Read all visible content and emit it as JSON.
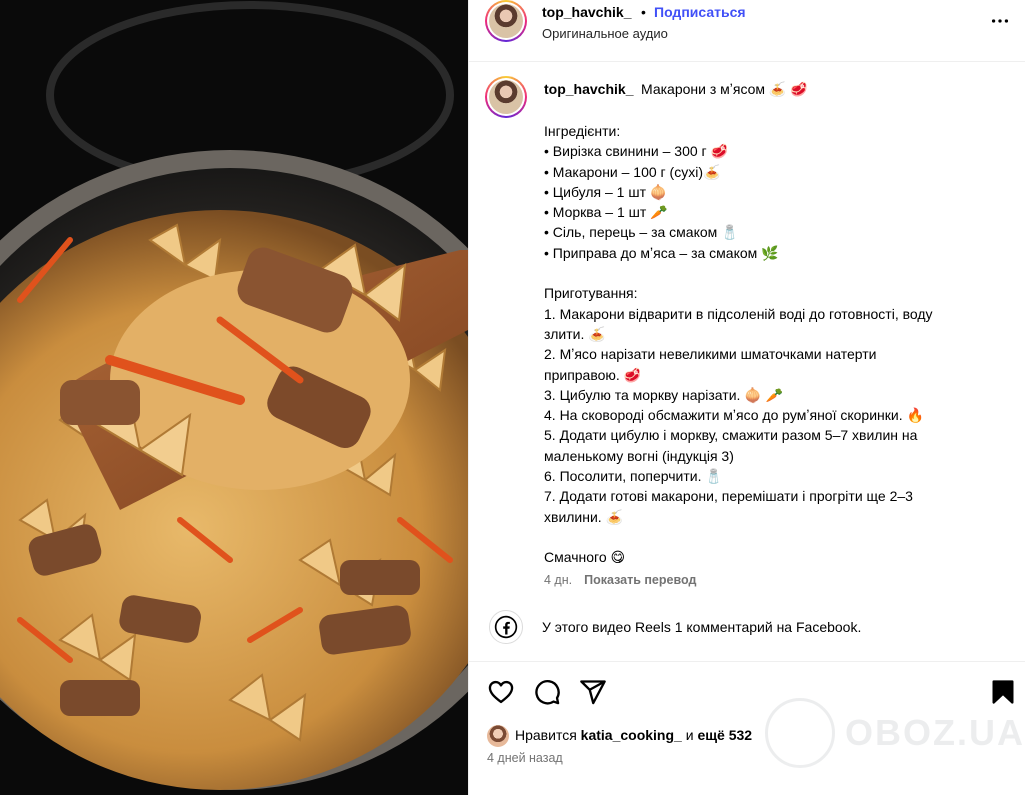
{
  "header": {
    "username": "top_havchik_",
    "separator": "•",
    "follow_label": "Подписаться",
    "audio_label": "Оригинальное аудио"
  },
  "caption": {
    "username": "top_havchik_",
    "title": "Макарони з мʼясом 🍝 🥩",
    "lines": [
      "Інгредієнти:",
      "• Вирізка свинини – 300 г 🥩",
      "• Макарони – 100 г (сухі)🍝",
      "• Цибуля – 1 шт 🧅",
      "• Морква – 1 шт 🥕",
      "• Сіль, перець – за смаком 🧂",
      "• Приправа до мʼяса – за смаком 🌿",
      "",
      "Приготування:",
      "1. Макарони відварити в підсоленій воді до готовності, воду",
      "злити. 🍝",
      "2. Мʼясо нарізати невеликими шматочками натерти",
      "приправою. 🥩",
      "3. Цибулю та моркву нарізати. 🧅 🥕",
      "4. На сковороді обсмажити мʼясо до румʼяної скоринки. 🔥",
      "5. Додати цибулю і моркву, смажити разом 5–7 хвилин на",
      "маленькому вогні (індукція 3)",
      "6. Посолити, поперчити. 🧂",
      "7. Додати готові макарони, перемішати і прогріти ще 2–3",
      "хвилини. 🍝",
      "",
      "Смачного 😋"
    ],
    "age": "4 дн.",
    "translate_label": "Показать перевод"
  },
  "facebook_note": "У этого видео Reels 1 комментарий на Facebook.",
  "likes": {
    "prefix": "Нравится ",
    "user": "katia_cooking_",
    "middle": " и ",
    "count": "ещё 532"
  },
  "posted_ago": "4 дней назад",
  "watermark": "OBOZ.UA",
  "icons": {
    "more": "more-horizontal-icon",
    "like": "heart-icon",
    "comment": "comment-icon",
    "share": "send-icon",
    "save": "bookmark-icon",
    "facebook": "facebook-icon"
  },
  "colors": {
    "follow": "#4150f7",
    "muted": "#737373",
    "border": "#efefef"
  }
}
